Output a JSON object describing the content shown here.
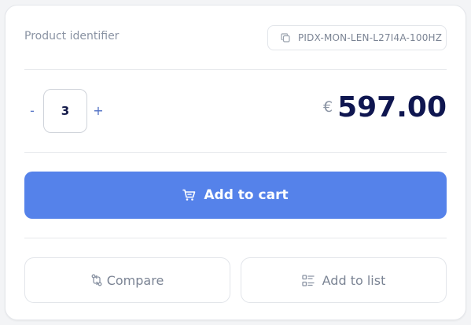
{
  "product": {
    "identifier_label": "Product identifier",
    "identifier_value": "PIDX-MON-LEN-L27I4A-100HZ"
  },
  "quantity": {
    "minus_label": "-",
    "value": "3",
    "plus_label": "+"
  },
  "price": {
    "currency": "€",
    "amount": "597.00"
  },
  "actions": {
    "add_to_cart_label": "Add to cart",
    "compare_label": "Compare",
    "add_to_list_label": "Add to list"
  },
  "colors": {
    "primary": "#5582ea",
    "price_text": "#0f1650",
    "muted_text": "#8a93a3",
    "border": "#e2e5ea"
  },
  "icons": {
    "identifier": "copy-icon",
    "cart": "cart-icon",
    "compare": "compare-icon",
    "list": "list-icon"
  }
}
